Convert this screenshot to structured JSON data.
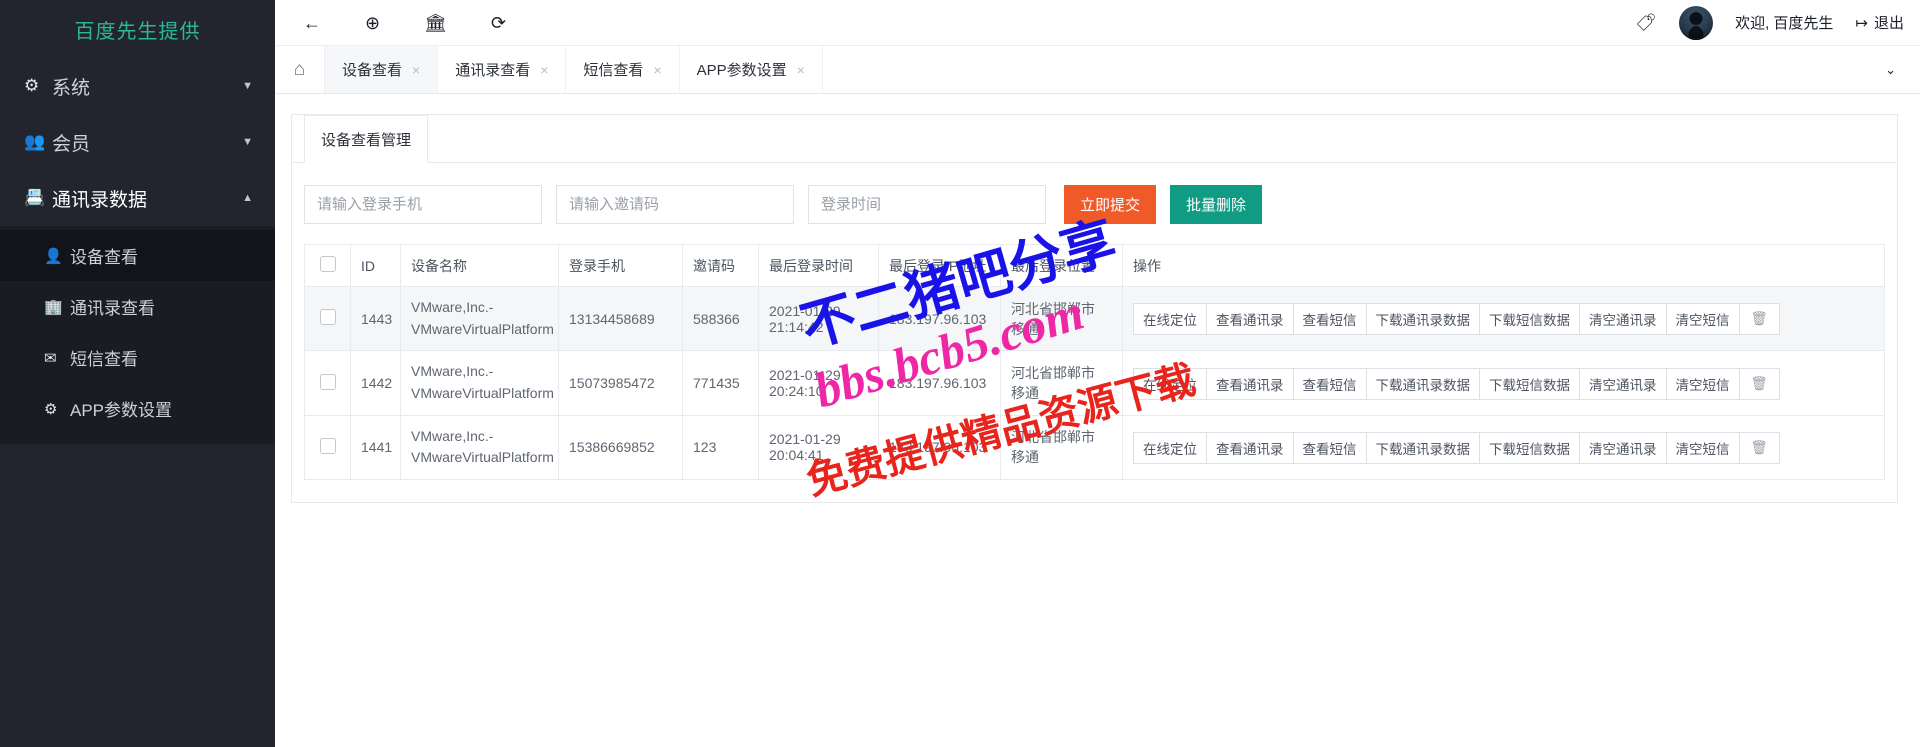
{
  "sidebar": {
    "brand": "百度先生提供",
    "items": [
      {
        "icon": "gear-icon",
        "glyph": "⚙",
        "label": "系统",
        "caret": "▼",
        "expanded": false
      },
      {
        "icon": "users-icon",
        "glyph": "👥",
        "label": "会员",
        "caret": "▼",
        "expanded": false
      },
      {
        "icon": "contact-card-icon",
        "glyph": "📇",
        "label": "通讯录数据",
        "caret": "▲",
        "expanded": true
      }
    ],
    "submenu": [
      {
        "icon": "person-icon",
        "glyph": "👤",
        "label": "设备查看",
        "active": true
      },
      {
        "icon": "building-icon",
        "glyph": "🏢",
        "label": "通讯录查看",
        "active": false
      },
      {
        "icon": "envelope-icon",
        "glyph": "✉",
        "label": "短信查看",
        "active": false
      },
      {
        "icon": "gear-icon",
        "glyph": "⚙",
        "label": "APP参数设置",
        "active": false
      }
    ]
  },
  "topbar": {
    "icons": [
      {
        "name": "back-arrow-icon",
        "glyph": "←"
      },
      {
        "name": "lifebuoy-icon",
        "glyph": "⊕"
      },
      {
        "name": "bank-icon",
        "glyph": "🏛"
      },
      {
        "name": "refresh-icon",
        "glyph": "⟳"
      }
    ],
    "tag_icon": "🏷",
    "welcome": "欢迎, 百度先生",
    "logout_icon": "↦",
    "logout": "退出"
  },
  "tabbar": {
    "home_icon": "⌂",
    "tabs": [
      {
        "label": "设备查看",
        "active": true,
        "close": "×"
      },
      {
        "label": "通讯录查看",
        "active": false,
        "close": "×"
      },
      {
        "label": "短信查看",
        "active": false,
        "close": "×"
      },
      {
        "label": "APP参数设置",
        "active": false,
        "close": "×"
      }
    ],
    "dropdown_icon": "⌄"
  },
  "card": {
    "tab_label": "设备查看管理",
    "filters": {
      "phone_placeholder": "请输入登录手机",
      "phone_value": "",
      "code_placeholder": "请输入邀请码",
      "code_value": "",
      "time_placeholder": "登录时间",
      "time_value": "",
      "submit_label": "立即提交",
      "batch_delete_label": "批量删除",
      "submit_color": "#f05a28",
      "batch_color": "#0f9b84"
    },
    "table": {
      "columns": [
        "",
        "ID",
        "设备名称",
        "登录手机",
        "邀请码",
        "最后登录时间",
        "最后登录IP地址",
        "最后登录位置",
        "操作"
      ],
      "action_labels": [
        "在线定位",
        "查看通讯录",
        "查看短信",
        "下载通讯录数据",
        "下载短信数据",
        "清空通讯录",
        "清空短信"
      ],
      "trash_icon": "🗑",
      "rows": [
        {
          "id": "1443",
          "device": "VMware,Inc.-VMwareVirtualPlatform",
          "phone": "13134458689",
          "code": "588366",
          "time": "2021-01-29 21:14:42",
          "ip": "183.197.96.103",
          "location": "河北省邯郸市 移通"
        },
        {
          "id": "1442",
          "device": "VMware,Inc.-VMwareVirtualPlatform",
          "phone": "15073985472",
          "code": "771435",
          "time": "2021-01-29 20:24:10",
          "ip": "183.197.96.103",
          "location": "河北省邯郸市 移通"
        },
        {
          "id": "1441",
          "device": "VMware,Inc.-VMwareVirtualPlatform",
          "phone": "15386669852",
          "code": "123",
          "time": "2021-01-29 20:04:41",
          "ip": "183.197.96.103",
          "location": "河北省邯郸市 移通"
        }
      ]
    }
  },
  "watermarks": [
    {
      "text": "不二猪吧分享",
      "color": "#1a13e8"
    },
    {
      "text": "bbs.bcb5.com",
      "color": "#ee27a6"
    },
    {
      "text": "免费提供精品资源下载",
      "color": "#e8241c"
    }
  ]
}
